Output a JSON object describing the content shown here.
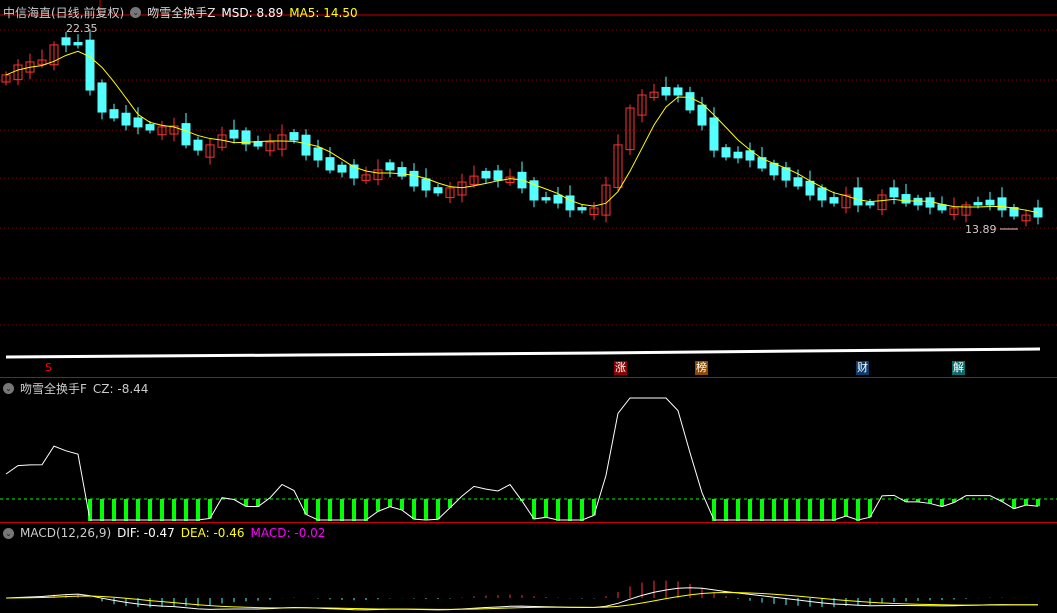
{
  "main": {
    "stock": "中信海直(日线,前复权)",
    "indicator": "吻雪全换手Z",
    "msd": "MSD: 8.89",
    "ma5": "MA5: 14.50",
    "high_label": "22.35",
    "low_label": "13.89"
  },
  "markers": [
    {
      "text": "S",
      "color": "#000",
      "fg": "#f00"
    },
    {
      "text": "涨",
      "color": "#8b0000",
      "fg": "#fff"
    },
    {
      "text": "榜",
      "color": "#8b4a00",
      "fg": "#fff"
    },
    {
      "text": "财",
      "color": "#0b3c6b",
      "fg": "#fff"
    },
    {
      "text": "解",
      "color": "#0b6b6b",
      "fg": "#fff"
    }
  ],
  "cz_panel": {
    "title": "吻雪全换手F",
    "value": "CZ: -8.44"
  },
  "macd_panel": {
    "title": "MACD(12,26,9)",
    "dif": "DIF: -0.47",
    "dea": "DEA: -0.46",
    "macd": "MACD: -0.02"
  },
  "colors": {
    "up": "#ff3232",
    "down": "#54ffff",
    "ma": "#ffff00",
    "grid": "#8b0000"
  },
  "chart_data": {
    "type": "candlestick",
    "price_range": [
      13.89,
      22.35
    ],
    "closes": [
      20.45,
      20.87,
      21.0,
      21.08,
      21.72,
      21.72,
      21.72,
      19.81,
      18.88,
      18.63,
      18.33,
      18.25,
      18.12,
      18.25,
      18.29,
      17.49,
      17.27,
      17.49,
      17.91,
      17.78,
      17.53,
      17.44,
      17.61,
      17.91,
      17.7,
      17.06,
      16.85,
      16.43,
      16.34,
      16.09,
      16.22,
      16.43,
      16.43,
      16.17,
      15.75,
      15.58,
      15.46,
      15.67,
      15.92,
      16.17,
      16.09,
      16.0,
      16.13,
      15.67,
      15.16,
      15.16,
      15.03,
      14.74,
      14.74,
      14.82,
      15.79,
      17.49,
      19.05,
      19.6,
      19.72,
      19.6,
      19.6,
      18.97,
      18.33,
      17.27,
      16.98,
      16.94,
      16.85,
      16.51,
      16.22,
      16.0,
      15.75,
      15.37,
      15.16,
      15.03,
      15.37,
      14.95,
      14.95,
      15.37,
      15.29,
      15.03,
      14.95,
      14.86,
      14.74,
      14.82,
      14.95,
      14.95,
      14.95,
      14.74,
      14.48,
      14.52,
      14.44
    ]
  }
}
